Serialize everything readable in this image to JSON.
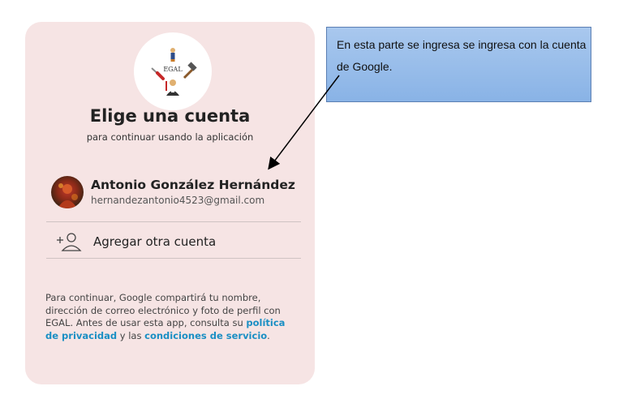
{
  "dialog": {
    "logo_text": "EGAL",
    "title": "Elige una cuenta",
    "subtitle": "para continuar usando la aplicación",
    "account": {
      "name": "Antonio González Hernández",
      "email": "hernandezantonio4523@gmail.com"
    },
    "add_account_label": "Agregar otra cuenta",
    "footer": {
      "text_1": "Para continuar, Google compartirá tu nombre, dirección de correo electrónico y foto de perfil con EGAL. Antes de usar esta app, consulta su ",
      "privacy_link": "política de privacidad",
      "text_2": " y las ",
      "terms_link": "condiciones de servicio",
      "text_3": "."
    }
  },
  "annotation": {
    "text": "En esta parte se ingresa se ingresa con la cuenta de Google."
  },
  "colors": {
    "card_bg": "#f6e4e4",
    "link": "#1a8fc4",
    "note_bg": "#9dbfea"
  }
}
